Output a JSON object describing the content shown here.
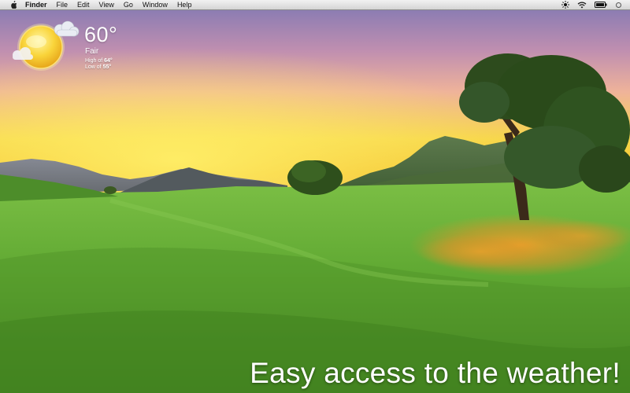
{
  "menubar": {
    "apple_icon": "apple-logo-icon",
    "app_name": "Finder",
    "items": [
      "File",
      "Edit",
      "View",
      "Go",
      "Window",
      "Help"
    ],
    "status_icons": [
      "brightness-icon",
      "wifi-icon",
      "battery-icon",
      "spotlight-icon"
    ]
  },
  "weather": {
    "icon": "sunny-partly-cloudy-icon",
    "temperature": "60°",
    "condition": "Fair",
    "high_label": "High of ",
    "high_value": "64°",
    "low_label": "Low of ",
    "low_value": "55°"
  },
  "caption": "Easy access to the weather!",
  "colors": {
    "sky_top": "#8d7fb8",
    "sky_mid": "#e7a7a2",
    "sunset": "#f7d23a",
    "grass": "#6fb43a",
    "sun": "#f5c82a"
  }
}
